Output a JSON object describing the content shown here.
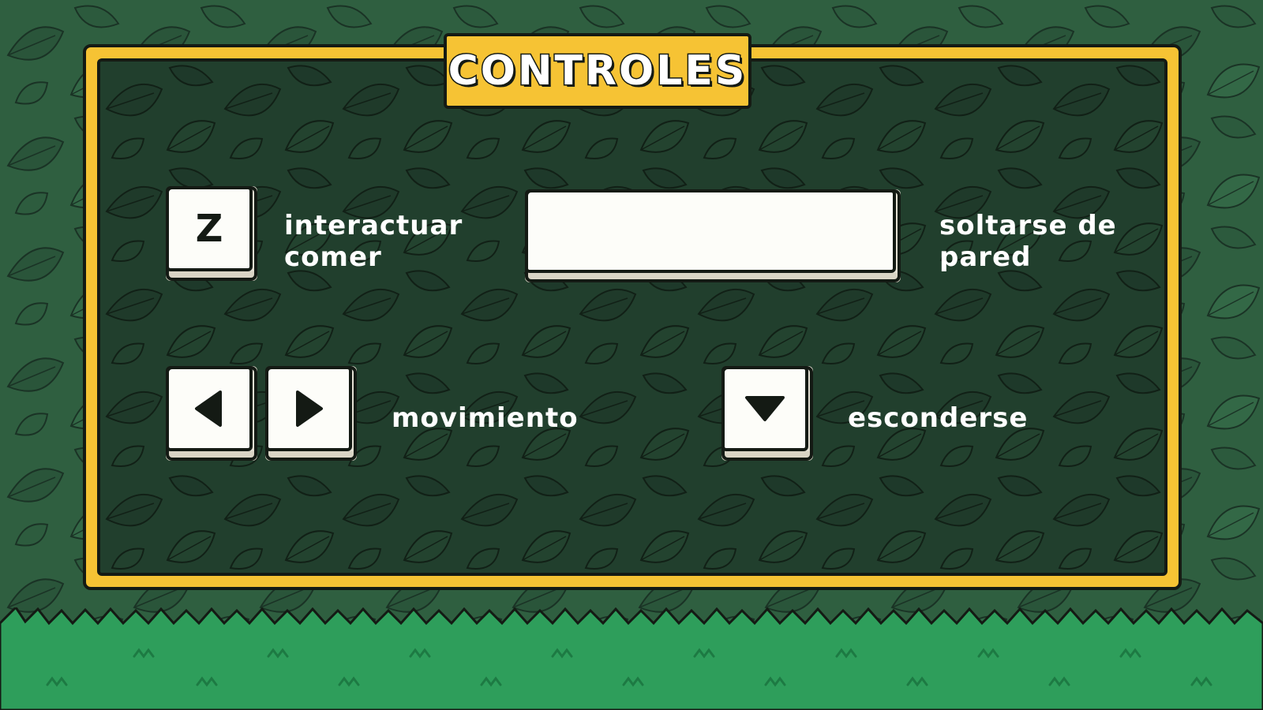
{
  "title": "CONTROLES",
  "controls": {
    "interact": {
      "key": "Z",
      "label_line1": "interactuar",
      "label_line2": "comer"
    },
    "wall": {
      "key": "",
      "label_line1": "soltarse de",
      "label_line2": "pared"
    },
    "move": {
      "left_icon": "arrow-left-icon",
      "right_icon": "arrow-right-icon",
      "label": "movimiento"
    },
    "hide": {
      "icon": "arrow-down-icon",
      "label": "esconderse"
    }
  },
  "colors": {
    "frame": "#f6c334",
    "panel": "#1f3a2a",
    "background": "#2c5a3d",
    "grass": "#2e9e5b",
    "key_face": "#fdfdf9",
    "outline": "#141a14"
  }
}
